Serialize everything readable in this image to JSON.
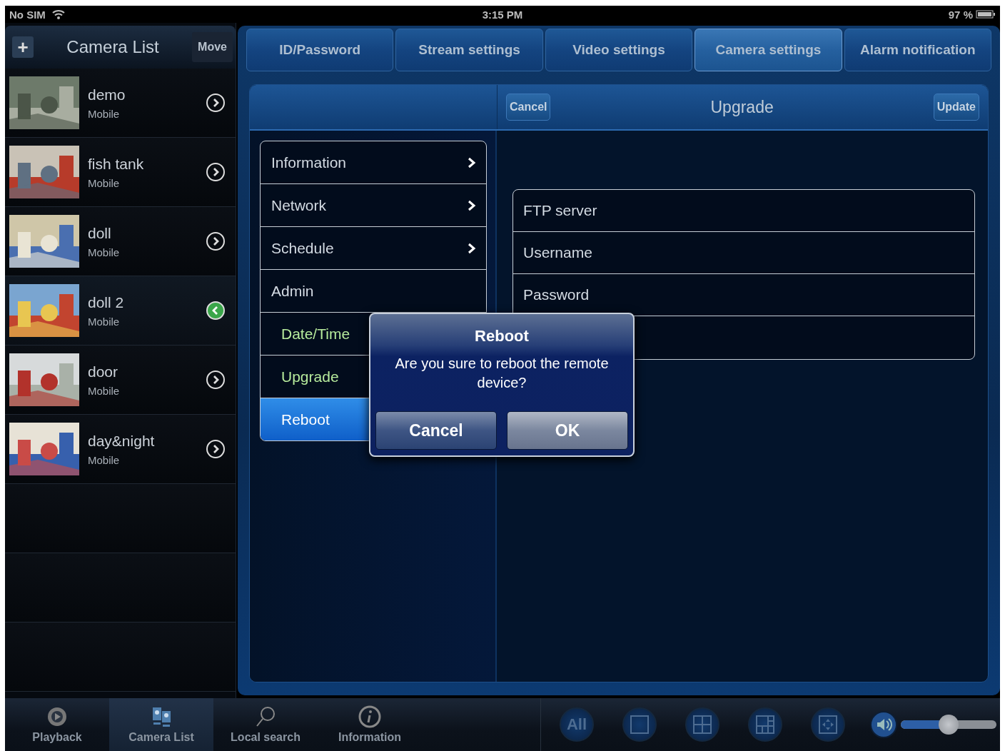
{
  "status_bar": {
    "carrier": "No SIM",
    "time": "3:15 PM",
    "battery": "97 %"
  },
  "sidebar": {
    "add": "+",
    "title": "Camera List",
    "move": "Move",
    "cameras": [
      {
        "name": "demo",
        "type": "Mobile",
        "selected": false
      },
      {
        "name": "fish tank",
        "type": "Mobile",
        "selected": false
      },
      {
        "name": "doll",
        "type": "Mobile",
        "selected": false
      },
      {
        "name": "doll 2",
        "type": "Mobile",
        "selected": true
      },
      {
        "name": "door",
        "type": "Mobile",
        "selected": false
      },
      {
        "name": "day&night",
        "type": "Mobile",
        "selected": false
      }
    ]
  },
  "tabs": [
    {
      "label": "ID/Password",
      "selected": false
    },
    {
      "label": "Stream settings",
      "selected": false
    },
    {
      "label": "Video settings",
      "selected": false
    },
    {
      "label": "Camera settings",
      "selected": true
    },
    {
      "label": "Alarm notification",
      "selected": false
    }
  ],
  "panel": {
    "cancel": "Cancel",
    "title": "Upgrade",
    "update": "Update"
  },
  "menu": [
    {
      "label": "Information",
      "chevron": true,
      "selected": false
    },
    {
      "label": "Network",
      "chevron": true,
      "selected": false
    },
    {
      "label": "Schedule",
      "chevron": true,
      "selected": false
    },
    {
      "label": "Admin",
      "chevron": false,
      "selected": false,
      "children": [
        {
          "label": "Date/Time",
          "selected": false
        },
        {
          "label": "Upgrade",
          "selected": false
        },
        {
          "label": "Reboot",
          "selected": true
        }
      ]
    }
  ],
  "fields": [
    {
      "placeholder": "FTP server"
    },
    {
      "placeholder": "Username"
    },
    {
      "placeholder": "Password"
    }
  ],
  "dialog": {
    "title": "Reboot",
    "message": "Are you sure to reboot the remote device?",
    "buttons": [
      "Cancel",
      "OK"
    ]
  },
  "bottom_tabs": [
    {
      "label": "Playback",
      "selected": false
    },
    {
      "label": "Camera List",
      "selected": true
    },
    {
      "label": "Local search",
      "selected": false
    },
    {
      "label": "Information",
      "selected": false
    }
  ],
  "view_buttons": [
    {
      "kind": "all",
      "label": "All"
    },
    {
      "kind": "single"
    },
    {
      "kind": "quad"
    },
    {
      "kind": "multi"
    },
    {
      "kind": "full"
    }
  ],
  "volume": {
    "level": 0.5
  }
}
